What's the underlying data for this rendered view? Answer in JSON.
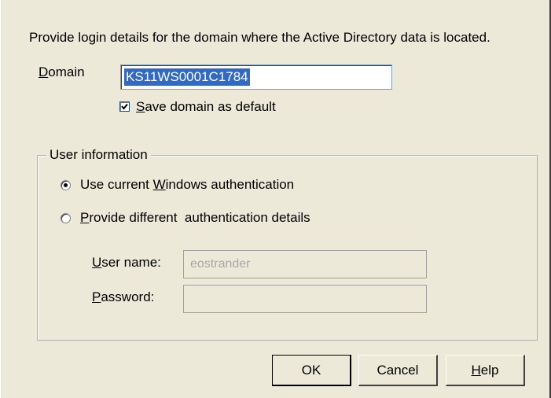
{
  "instructions": "Provide login details for the domain where the Active Directory data is located.",
  "domain": {
    "label_first": "D",
    "label_rest": "omain",
    "value": "KS11WS0001C1784"
  },
  "save_default": {
    "checked": true,
    "label_first": "S",
    "label_rest": "ave domain as default"
  },
  "user_info": {
    "legend": "User information",
    "option_windows": {
      "selected": true,
      "label_pre": "Use current ",
      "label_u": "W",
      "label_post": "indows authentication"
    },
    "option_different": {
      "selected": false,
      "label_u": "P",
      "label_post": "rovide different  authentication details"
    },
    "username": {
      "label_u": "U",
      "label_post": "ser name:",
      "value": "eostrander"
    },
    "password": {
      "label_u": "P",
      "label_post": "assword:",
      "value": ""
    }
  },
  "buttons": {
    "ok": "OK",
    "cancel": "Cancel",
    "help_u": "H",
    "help_rest": "elp"
  },
  "colors": {
    "dialog_bg": "#ece9d8",
    "selection": "#316ac5"
  }
}
